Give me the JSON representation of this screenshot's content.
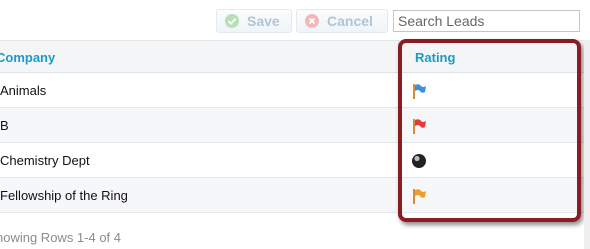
{
  "toolbar": {
    "save_label": "Save",
    "cancel_label": "Cancel",
    "search_placeholder": "Search Leads"
  },
  "table": {
    "columns": [
      "Company",
      "Rating"
    ],
    "rows": [
      {
        "company": "Animals",
        "rating_icon": "blue-flag-icon",
        "rating_color": "#3d8fe0"
      },
      {
        "company": "B",
        "rating_icon": "red-flag-icon",
        "rating_color": "#e23b3b"
      },
      {
        "company": "Chemistry Dept",
        "rating_icon": "black-ball-icon",
        "rating_color": "#222222"
      },
      {
        "company": "Fellowship of the Ring",
        "rating_icon": "orange-flag-icon",
        "rating_color": "#f39a2c"
      }
    ]
  },
  "footer": {
    "showing": "howing Rows 1-4 of 4"
  },
  "colors": {
    "header_text": "#1a9bc9",
    "highlight": "#8a1c24"
  }
}
